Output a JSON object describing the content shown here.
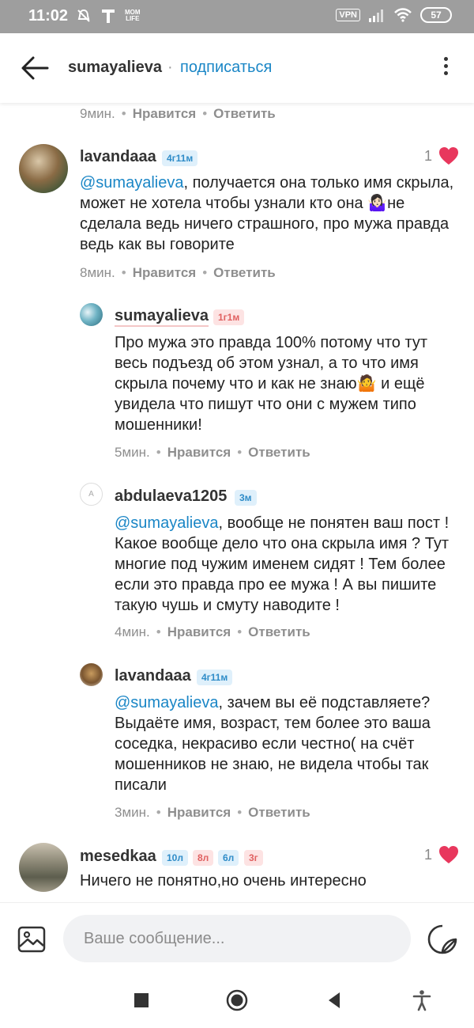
{
  "status_bar": {
    "time": "11:02",
    "momlife_line1": "MOM",
    "momlife_line2": "LIFE",
    "vpn": "VPN",
    "battery": "57"
  },
  "header": {
    "username": "sumayalieva",
    "dot": "·",
    "subscribe": "подписаться"
  },
  "actions": {
    "like": "Нравится",
    "reply": "Ответить"
  },
  "comments": [
    {
      "time": "9мин."
    },
    {
      "username": "lavandaaa",
      "badges": [
        "4г11м"
      ],
      "likes": "1",
      "mention": "@sumayalieva",
      "text_before_emoji": ", получается она только имя скрыла, может не хотела чтобы узнали кто она ",
      "emoji": "🤷🏻‍♀️",
      "text_after_emoji": "не сделала ведь ничего страшного, про мужа правда ведь как вы говорите",
      "time": "8мин."
    },
    {
      "username": "sumayalieva",
      "badges": [
        "1г1м"
      ],
      "text_before_emoji": "Про мужа это правда 100% потому что тут весь подъезд об этом узнал,  а то что имя скрыла почему что и как не знаю",
      "emoji": "🤷",
      "text_after_emoji": "  и ещё увидела что пишут что они с мужем типо мошенники!",
      "time": "5мин."
    },
    {
      "username": "abdulaeva1205",
      "avatar_letter": "A",
      "badges": [
        "3м"
      ],
      "mention": "@sumayalieva",
      "text": ", вообще не понятен ваш пост ! Какое вообще дело что она скрыла имя ? Тут многие под чужим именем сидят ! Тем более если это правда про ее мужа ! А вы пишите такую чушь и смуту наводите !",
      "time": "4мин."
    },
    {
      "username": "lavandaaa",
      "badges": [
        "4г11м"
      ],
      "mention": "@sumayalieva",
      "text": ", зачем вы её подставляете? Выдаёте имя, возраст, тем более это ваша соседка, некрасиво если честно( на счёт мошенников не знаю, не видела чтобы так писали",
      "time": "3мин."
    },
    {
      "username": "mesedkaa",
      "badges": [
        "10л",
        "8л",
        "6л",
        "3г"
      ],
      "likes": "1",
      "text": "Ничего не понятно,но очень интересно"
    }
  ],
  "composer": {
    "placeholder": "Ваше сообщение..."
  },
  "colors": {
    "accent": "#1a86c6",
    "heart": "#e8375d",
    "badge_blue_bg": "#dff0fb",
    "badge_red_bg": "#fde3e3"
  },
  "icons": [
    "back-arrow-icon",
    "more-vert-icon",
    "heart-icon",
    "image-icon",
    "sticker-icon",
    "nav-stop-icon",
    "nav-home-icon",
    "nav-back-icon",
    "accessibility-icon"
  ]
}
